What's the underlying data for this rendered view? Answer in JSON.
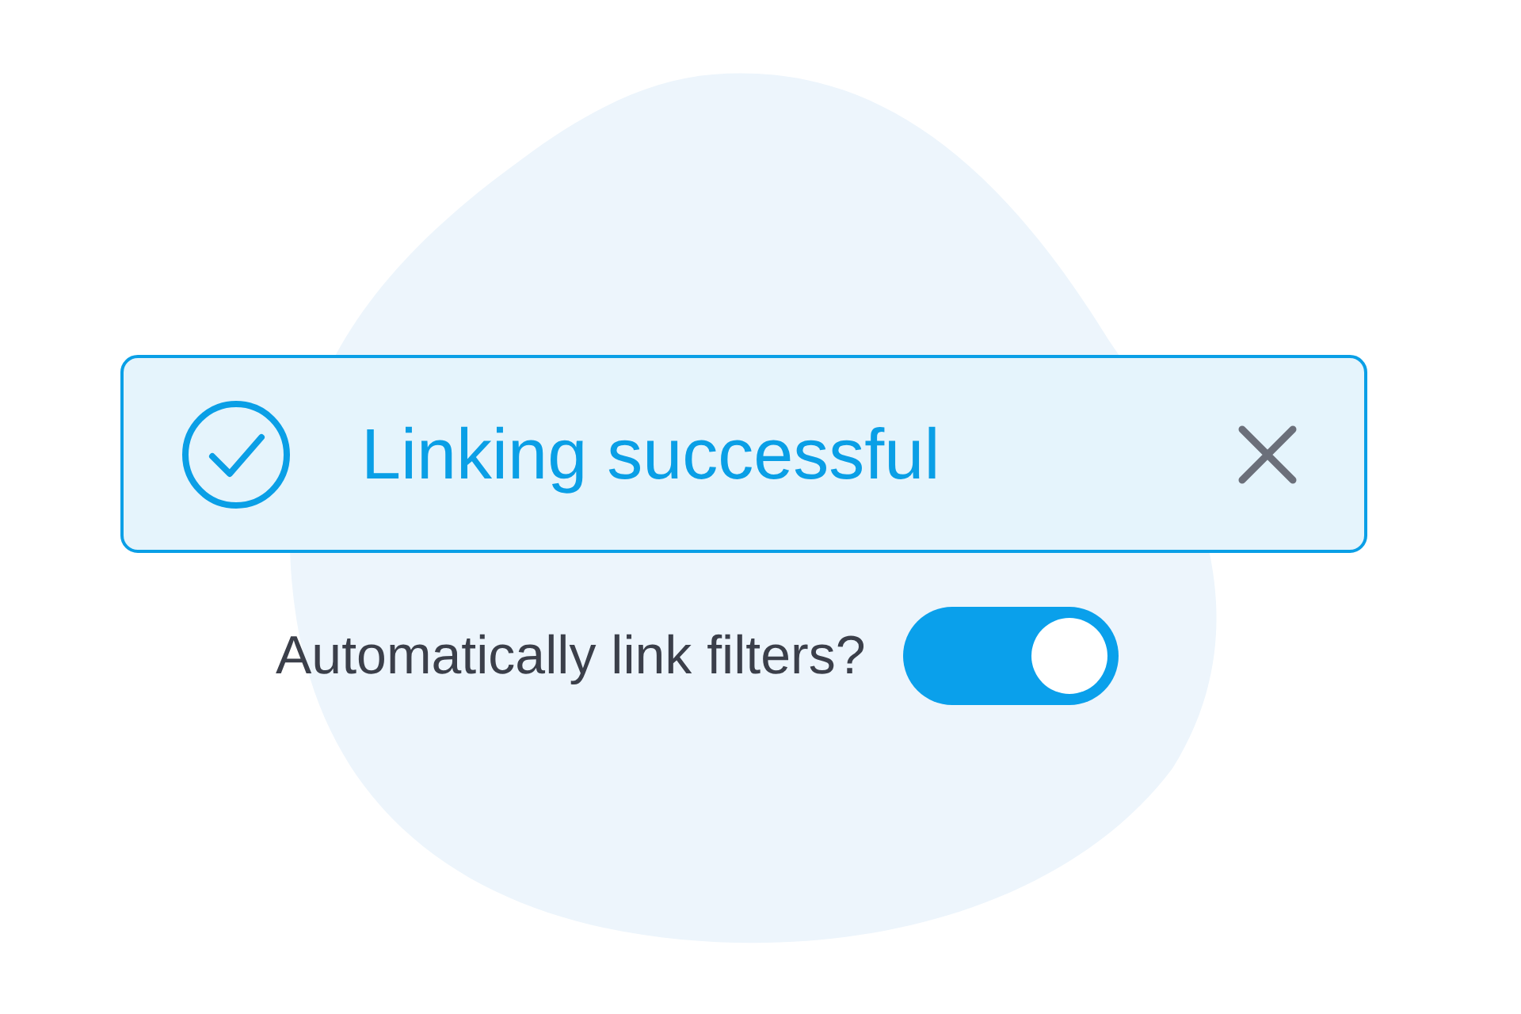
{
  "banner": {
    "kind": "success",
    "message": "Linking successful"
  },
  "setting": {
    "label": "Automatically link filters?",
    "on": true
  }
}
